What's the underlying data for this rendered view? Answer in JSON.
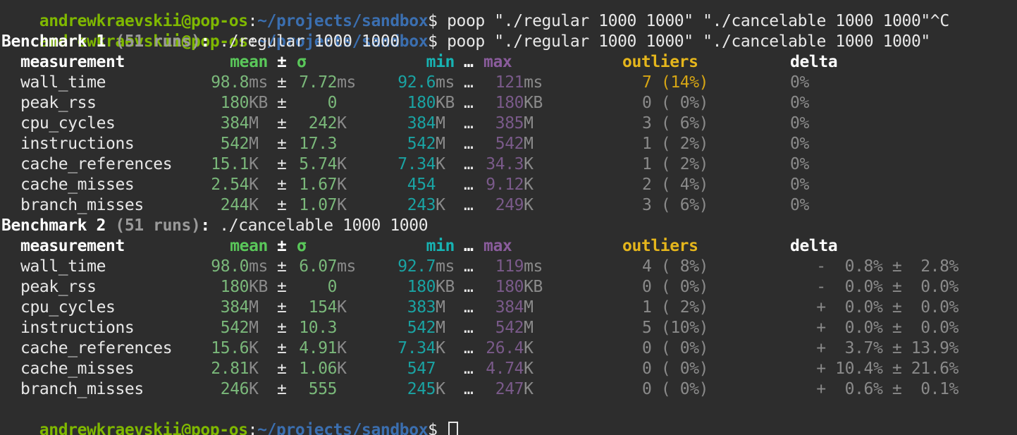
{
  "prompt": {
    "user": "andrewkraevskii@pop-os",
    "sep": ":",
    "path": "~/projects/sandbox",
    "dollar": "$ "
  },
  "prev_command": "poop \"./regular 1000 1000\" \"./cancelable 1000 1000\"^C",
  "command": "poop \"./regular 1000 1000\" \"./cancelable 1000 1000\"",
  "benchmarks": [
    {
      "title": "Benchmark 1",
      "runs": "(51 runs)",
      "colon": ":",
      "cmd": " ./regular 1000 1000",
      "header": {
        "measurement": "measurement",
        "mean": "mean",
        "pm": "±",
        "sigma": "σ",
        "min": "min",
        "ellipsis": "…",
        "max": "max",
        "outliers": "outliers",
        "delta": "delta"
      },
      "rows": [
        {
          "name": "wall_time",
          "mean": "98.8",
          "mean_u": "ms",
          "sd": "7.72",
          "sd_u": "ms",
          "min": "92.6",
          "min_u": "ms",
          "max": "121",
          "max_u": "ms",
          "out": "7 (14%)",
          "delta": "0%"
        },
        {
          "name": "peak_rss",
          "mean": "180",
          "mean_u": "KB",
          "sd": "0",
          "sd_u": "",
          "min": "180",
          "min_u": "KB",
          "max": "180",
          "max_u": "KB",
          "out": "0 ( 0%)",
          "delta": "0%"
        },
        {
          "name": "cpu_cycles",
          "mean": "384",
          "mean_u": "M",
          "sd": "242",
          "sd_u": "K",
          "min": "384",
          "min_u": "M",
          "max": "385",
          "max_u": "M",
          "out": "3 ( 6%)",
          "delta": "0%"
        },
        {
          "name": "instructions",
          "mean": "542",
          "mean_u": "M",
          "sd": "17.3",
          "sd_u": "",
          "min": "542",
          "min_u": "M",
          "max": "542",
          "max_u": "M",
          "out": "1 ( 2%)",
          "delta": "0%"
        },
        {
          "name": "cache_references",
          "mean": "15.1",
          "mean_u": "K",
          "sd": "5.74",
          "sd_u": "K",
          "min": "7.34",
          "min_u": "K",
          "max": "34.3",
          "max_u": "K",
          "out": "1 ( 2%)",
          "delta": "0%"
        },
        {
          "name": "cache_misses",
          "mean": "2.54",
          "mean_u": "K",
          "sd": "1.67",
          "sd_u": "K",
          "min": "454",
          "min_u": "",
          "max": "9.12",
          "max_u": "K",
          "out": "2 ( 4%)",
          "delta": "0%"
        },
        {
          "name": "branch_misses",
          "mean": "244",
          "mean_u": "K",
          "sd": "1.07",
          "sd_u": "K",
          "min": "243",
          "min_u": "K",
          "max": "249",
          "max_u": "K",
          "out": "3 ( 6%)",
          "delta": "0%"
        }
      ]
    },
    {
      "title": "Benchmark 2",
      "runs": "(51 runs)",
      "colon": ":",
      "cmd": " ./cancelable 1000 1000",
      "header": {
        "measurement": "measurement",
        "mean": "mean",
        "pm": "±",
        "sigma": "σ",
        "min": "min",
        "ellipsis": "…",
        "max": "max",
        "outliers": "outliers",
        "delta": "delta"
      },
      "rows": [
        {
          "name": "wall_time",
          "mean": "98.0",
          "mean_u": "ms",
          "sd": "6.07",
          "sd_u": "ms",
          "min": "92.7",
          "min_u": "ms",
          "max": "119",
          "max_u": "ms",
          "out": "4 ( 8%)",
          "delta": "-  0.8% ±  2.8%"
        },
        {
          "name": "peak_rss",
          "mean": "180",
          "mean_u": "KB",
          "sd": "0",
          "sd_u": "",
          "min": "180",
          "min_u": "KB",
          "max": "180",
          "max_u": "KB",
          "out": "0 ( 0%)",
          "delta": "-  0.0% ±  0.0%"
        },
        {
          "name": "cpu_cycles",
          "mean": "384",
          "mean_u": "M",
          "sd": "154",
          "sd_u": "K",
          "min": "383",
          "min_u": "M",
          "max": "384",
          "max_u": "M",
          "out": "1 ( 2%)",
          "delta": "+  0.0% ±  0.0%"
        },
        {
          "name": "instructions",
          "mean": "542",
          "mean_u": "M",
          "sd": "10.3",
          "sd_u": "",
          "min": "542",
          "min_u": "M",
          "max": "542",
          "max_u": "M",
          "out": "5 (10%)",
          "delta": "+  0.0% ±  0.0%"
        },
        {
          "name": "cache_references",
          "mean": "15.6",
          "mean_u": "K",
          "sd": "4.91",
          "sd_u": "K",
          "min": "7.34",
          "min_u": "K",
          "max": "26.4",
          "max_u": "K",
          "out": "0 ( 0%)",
          "delta": "+  3.7% ± 13.9%"
        },
        {
          "name": "cache_misses",
          "mean": "2.81",
          "mean_u": "K",
          "sd": "1.06",
          "sd_u": "K",
          "min": "547",
          "min_u": "",
          "max": "4.74",
          "max_u": "K",
          "out": "0 ( 0%)",
          "delta": "+ 10.4% ± 21.6%"
        },
        {
          "name": "branch_misses",
          "mean": "246",
          "mean_u": "K",
          "sd": "555",
          "sd_u": "",
          "min": "245",
          "min_u": "K",
          "max": "247",
          "max_u": "K",
          "out": "0 ( 0%)",
          "delta": "+  0.6% ±  0.1%"
        }
      ]
    }
  ],
  "colors": {
    "background": "#2d2d2d",
    "prompt_user": "#7fb800",
    "prompt_path": "#3b6fb0",
    "mean": "#7ab87a",
    "min": "#1aa3a3",
    "max": "#7a5a8a",
    "outliers": "#d6a514"
  }
}
